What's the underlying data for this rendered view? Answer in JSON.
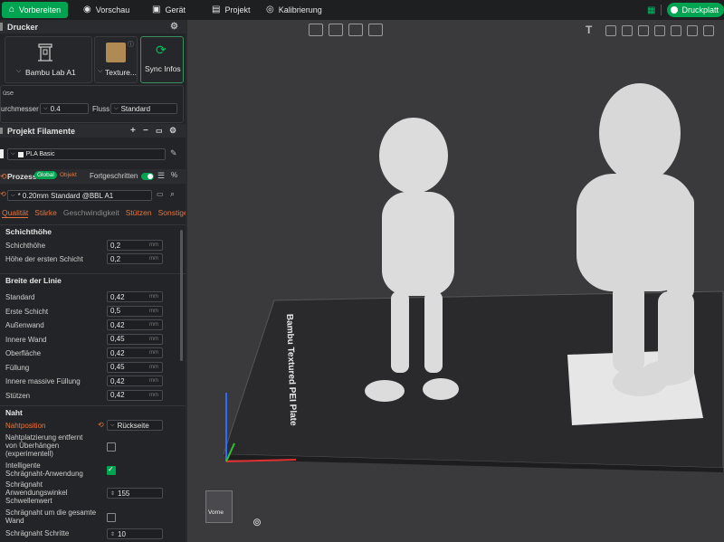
{
  "topbar": {
    "tabs": [
      {
        "label": "Vorbereiten",
        "icon": "home-icon"
      },
      {
        "label": "Vorschau",
        "icon": "eye-icon"
      },
      {
        "label": "Gerät",
        "icon": "device-icon"
      },
      {
        "label": "Projekt",
        "icon": "project-icon"
      },
      {
        "label": "Kalibrierung",
        "icon": "calibration-icon"
      }
    ],
    "print_button": "Druckplatt"
  },
  "printer": {
    "section_title": "Drucker",
    "printer_name": "Bambu Lab A1",
    "texture_label": "Texture...",
    "sync_label": "Sync Infos",
    "nozzle_title": "üse",
    "diameter_label": "urchmesser",
    "diameter_value": "0.4",
    "flow_label": "Fluss",
    "flow_value": "Standard"
  },
  "filaments": {
    "section_title": "Projekt Filamente",
    "item": "PLA Basic"
  },
  "process": {
    "section_title": "Prozess",
    "toggle_global": "Global",
    "toggle_object": "Objekt",
    "advanced_label": "Fortgeschritten",
    "preset": "* 0.20mm Standard @BBL A1"
  },
  "process_tabs": [
    "Qualität",
    "Stärke",
    "Geschwindigkeit",
    "Stützen",
    "Sonstige"
  ],
  "settings": {
    "layer_height_group": "Schichthöhe",
    "layer_height_rows": [
      {
        "label": "Schichthöhe",
        "value": "0,2",
        "unit": "mm"
      },
      {
        "label": "Höhe der ersten Schicht",
        "value": "0,2",
        "unit": "mm"
      }
    ],
    "line_width_group": "Breite der Linie",
    "line_width_rows": [
      {
        "label": "Standard",
        "value": "0,42",
        "unit": "mm"
      },
      {
        "label": "Erste Schicht",
        "value": "0,5",
        "unit": "mm"
      },
      {
        "label": "Außenwand",
        "value": "0,42",
        "unit": "mm"
      },
      {
        "label": "Innere Wand",
        "value": "0,45",
        "unit": "mm"
      },
      {
        "label": "Oberfläche",
        "value": "0,42",
        "unit": "mm"
      },
      {
        "label": "Füllung",
        "value": "0,45",
        "unit": "mm"
      },
      {
        "label": "Innere massive Füllung",
        "value": "0,42",
        "unit": "mm"
      },
      {
        "label": "Stützen",
        "value": "0,42",
        "unit": "mm"
      }
    ],
    "seam_group": "Naht",
    "seam_position_label": "Nahtposition",
    "seam_position_value": "Rückseite",
    "seam_away_label_1": "Nahtplatzierung entfernt",
    "seam_away_label_2": "von Überhängen",
    "seam_away_label_3": "(experimentell)",
    "scarf_label_1": "Intelligente",
    "scarf_label_2": "Schrägnaht-Anwendung",
    "scarf_angle_label_1": "Schrägnaht",
    "scarf_angle_label_2": "Anwendungswinkel",
    "scarf_angle_label_3": "Schwellenwert",
    "scarf_angle_value": "155",
    "scarf_all_label_1": "Schrägnaht um die gesamte",
    "scarf_all_label_2": "Wand",
    "scarf_steps_label": "Schrägnaht Schritte",
    "scarf_steps_value": "10"
  },
  "viewport": {
    "plate_label": "Bambu Textured PEI Plate",
    "view_cube_label": "Vorne"
  },
  "colors": {
    "accent": "#00a34f",
    "warning": "#e8743b"
  }
}
